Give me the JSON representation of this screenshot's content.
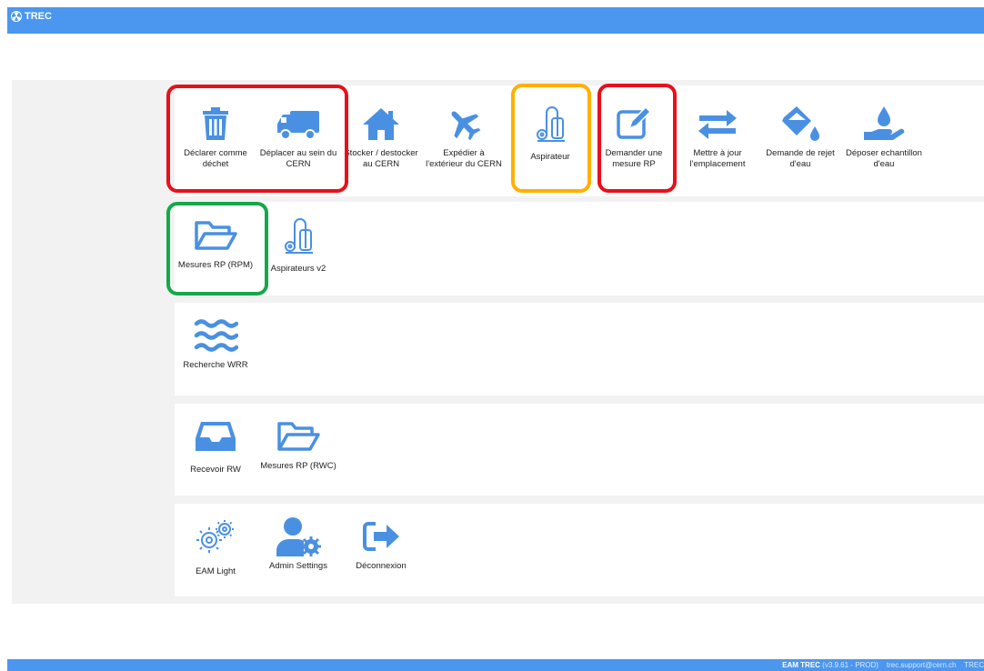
{
  "header": {
    "title": "TREC"
  },
  "section1": {
    "declare_waste": "Déclarer comme déchet",
    "move_cern": "Déplacer au sein du CERN",
    "store_cern": "Stocker / destocker au CERN",
    "ship_out": "Expédier à l'extérieur du CERN",
    "vacuum": "Aspirateur",
    "request_rp": "Demander une mesure RP",
    "update_location": "Mettre à jour l'emplacement",
    "water_discharge": "Demande de rejet d'eau",
    "water_sample": "Déposer echantillon d'eau"
  },
  "section2": {
    "rp_measures_rpm": "Mesures RP (RPM)",
    "vacuums_v2": "Aspirateurs v2"
  },
  "section3": {
    "search_wrr": "Recherche WRR"
  },
  "section4": {
    "receive_rw": "Recevoir RW",
    "rp_measures_rwc": "Mesures RP (RWC)"
  },
  "section5": {
    "eam_light": "EAM Light",
    "admin_settings": "Admin Settings",
    "logout": "Déconnexion"
  },
  "footer": {
    "app": "EAM TREC",
    "version": "(v3.9.61 - PROD)",
    "support": "trec.support@cern.ch",
    "tail": "TREC"
  },
  "colors": {
    "primary": "#4b97f0",
    "icon": "#4a90e2",
    "highlight_red": "#e8101a",
    "highlight_orange": "#ffb000",
    "highlight_green": "#15a84a"
  }
}
